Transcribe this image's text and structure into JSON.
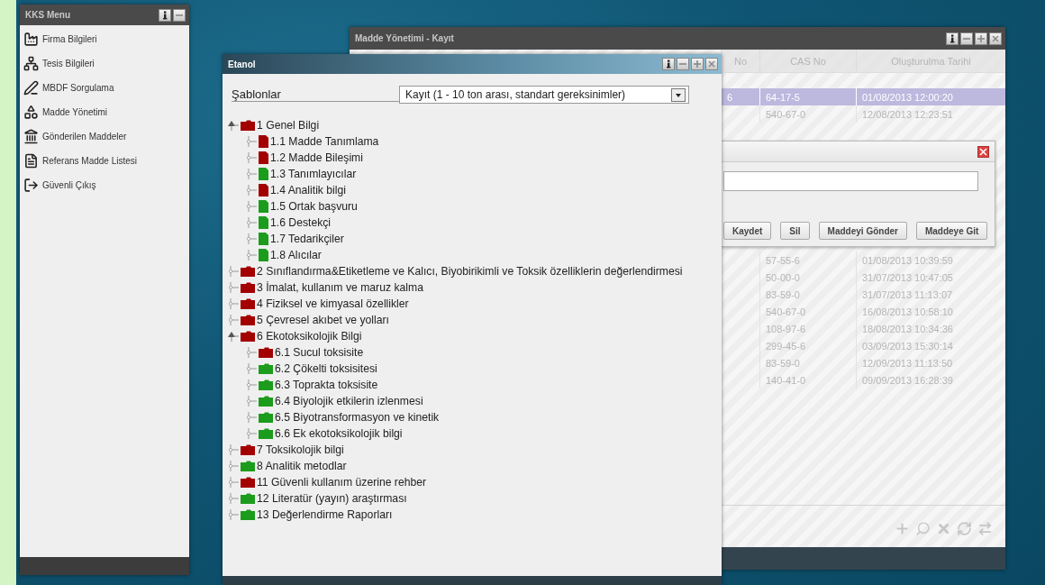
{
  "menu_window": {
    "title": "KKS Menu",
    "items": [
      {
        "label": "Firma Bilgileri"
      },
      {
        "label": "Tesis Bilgileri"
      },
      {
        "label": "MBDF Sorgulama"
      },
      {
        "label": "Madde Yönetimi"
      },
      {
        "label": "Gönderilen Maddeler"
      },
      {
        "label": "Referans Madde Listesi"
      },
      {
        "label": "Güvenli Çıkış"
      }
    ]
  },
  "madde_window": {
    "title": "Madde Yönetimi - Kayıt",
    "table": {
      "columns": [
        "No",
        "CAS No",
        "Oluşturulma Tarihi"
      ],
      "rows_top": [
        {
          "no": "6",
          "cas": "64-17-5",
          "date": "01/08/2013 12:00:20",
          "selected": true
        },
        {
          "cas": "540-67-0",
          "date": "12/08/2013 12:23:51",
          "selected": false
        }
      ],
      "rows_bottom": [
        {
          "cas": "57-55-6",
          "date": "01/08/2013 10:39:59",
          "selected": false
        },
        {
          "cas": "50-00-0",
          "date": "31/07/2013 10:47:05",
          "selected": false
        },
        {
          "cas": "83-59-0",
          "date": "31/07/2013 11:13:07",
          "selected": false
        },
        {
          "cas": "540-67-0",
          "date": "16/08/2013 10:58:10",
          "selected": false
        },
        {
          "cas": "108-97-6",
          "date": "18/08/2013 10:34:36",
          "selected": false
        },
        {
          "cas": "299-45-6",
          "date": "03/09/2013 15:30:14",
          "selected": false
        },
        {
          "cas": "83-59-0",
          "date": "12/09/2013 11:13:50",
          "selected": false
        },
        {
          "cas": "140-41-0",
          "date": "09/09/2013 16:28:39",
          "selected": false
        }
      ]
    },
    "dialog": {
      "buttons": [
        "Kaydet",
        "Sil",
        "Maddeyi Gönder",
        "Maddeye Git"
      ]
    }
  },
  "etanol_window": {
    "title": "Etanol",
    "template_label": "Şablonlar",
    "template_value": "Kayıt (1 - 10 ton arası, standart gereksinimler)",
    "tree": [
      {
        "label": "1 Genel Bilgi",
        "kind": "folder",
        "color": "#a30000",
        "expanded": true,
        "children": [
          {
            "label": "1.1 Madde Tanımlama",
            "kind": "file",
            "color": "#a30000"
          },
          {
            "label": "1.2 Madde Bileşimi",
            "kind": "file",
            "color": "#a30000"
          },
          {
            "label": "1.3 Tanımlayıcılar",
            "kind": "file",
            "color": "#1c9c1c"
          },
          {
            "label": "1.4 Analitik bilgi",
            "kind": "file",
            "color": "#a30000"
          },
          {
            "label": "1.5 Ortak başvuru",
            "kind": "file",
            "color": "#1c9c1c"
          },
          {
            "label": "1.6 Destekçi",
            "kind": "file",
            "color": "#1c9c1c"
          },
          {
            "label": "1.7 Tedarikçiler",
            "kind": "file",
            "color": "#1c9c1c"
          },
          {
            "label": "1.8 Alıcılar",
            "kind": "file",
            "color": "#1c9c1c"
          }
        ]
      },
      {
        "label": "2 Sınıflandırma&Etiketleme ve Kalıcı, Biyobirikimli ve Toksik özelliklerin değerlendirmesi",
        "kind": "folder",
        "color": "#a30000",
        "expanded": false
      },
      {
        "label": "3 İmalat, kullanım ve maruz kalma",
        "kind": "folder",
        "color": "#a30000",
        "expanded": false
      },
      {
        "label": "4 Fiziksel ve kimyasal özellikler",
        "kind": "folder",
        "color": "#a30000",
        "expanded": false
      },
      {
        "label": "5 Çevresel akıbet ve yolları",
        "kind": "folder",
        "color": "#a30000",
        "expanded": false
      },
      {
        "label": "6 Ekotoksikolojik Bilgi",
        "kind": "folder",
        "color": "#a30000",
        "expanded": true,
        "children": [
          {
            "label": "6.1 Sucul toksisite",
            "kind": "folder",
            "color": "#a30000"
          },
          {
            "label": "6.2 Çökelti toksisitesi",
            "kind": "folder",
            "color": "#1c9c1c"
          },
          {
            "label": "6.3 Toprakta toksisite",
            "kind": "folder",
            "color": "#1c9c1c"
          },
          {
            "label": "6.4 Biyolojik etkilerin izlenmesi",
            "kind": "folder",
            "color": "#1c9c1c"
          },
          {
            "label": "6.5 Biyotransformasyon ve kinetik",
            "kind": "folder",
            "color": "#1c9c1c"
          },
          {
            "label": "6.6 Ek ekotoksikolojik bilgi",
            "kind": "folder",
            "color": "#1c9c1c"
          }
        ]
      },
      {
        "label": "7 Toksikolojik bilgi",
        "kind": "folder",
        "color": "#a30000",
        "expanded": false
      },
      {
        "label": "8 Analitik metodlar",
        "kind": "folder",
        "color": "#1c9c1c",
        "expanded": false
      },
      {
        "label": "11 Güvenli kullanım üzerine rehber",
        "kind": "folder",
        "color": "#a30000",
        "expanded": false
      },
      {
        "label": "12 Literatür (yayın) araştırması",
        "kind": "folder",
        "color": "#1c9c1c",
        "expanded": false
      },
      {
        "label": "13 Değerlendirme Raporları",
        "kind": "folder",
        "color": "#1c9c1c",
        "expanded": false
      }
    ]
  }
}
